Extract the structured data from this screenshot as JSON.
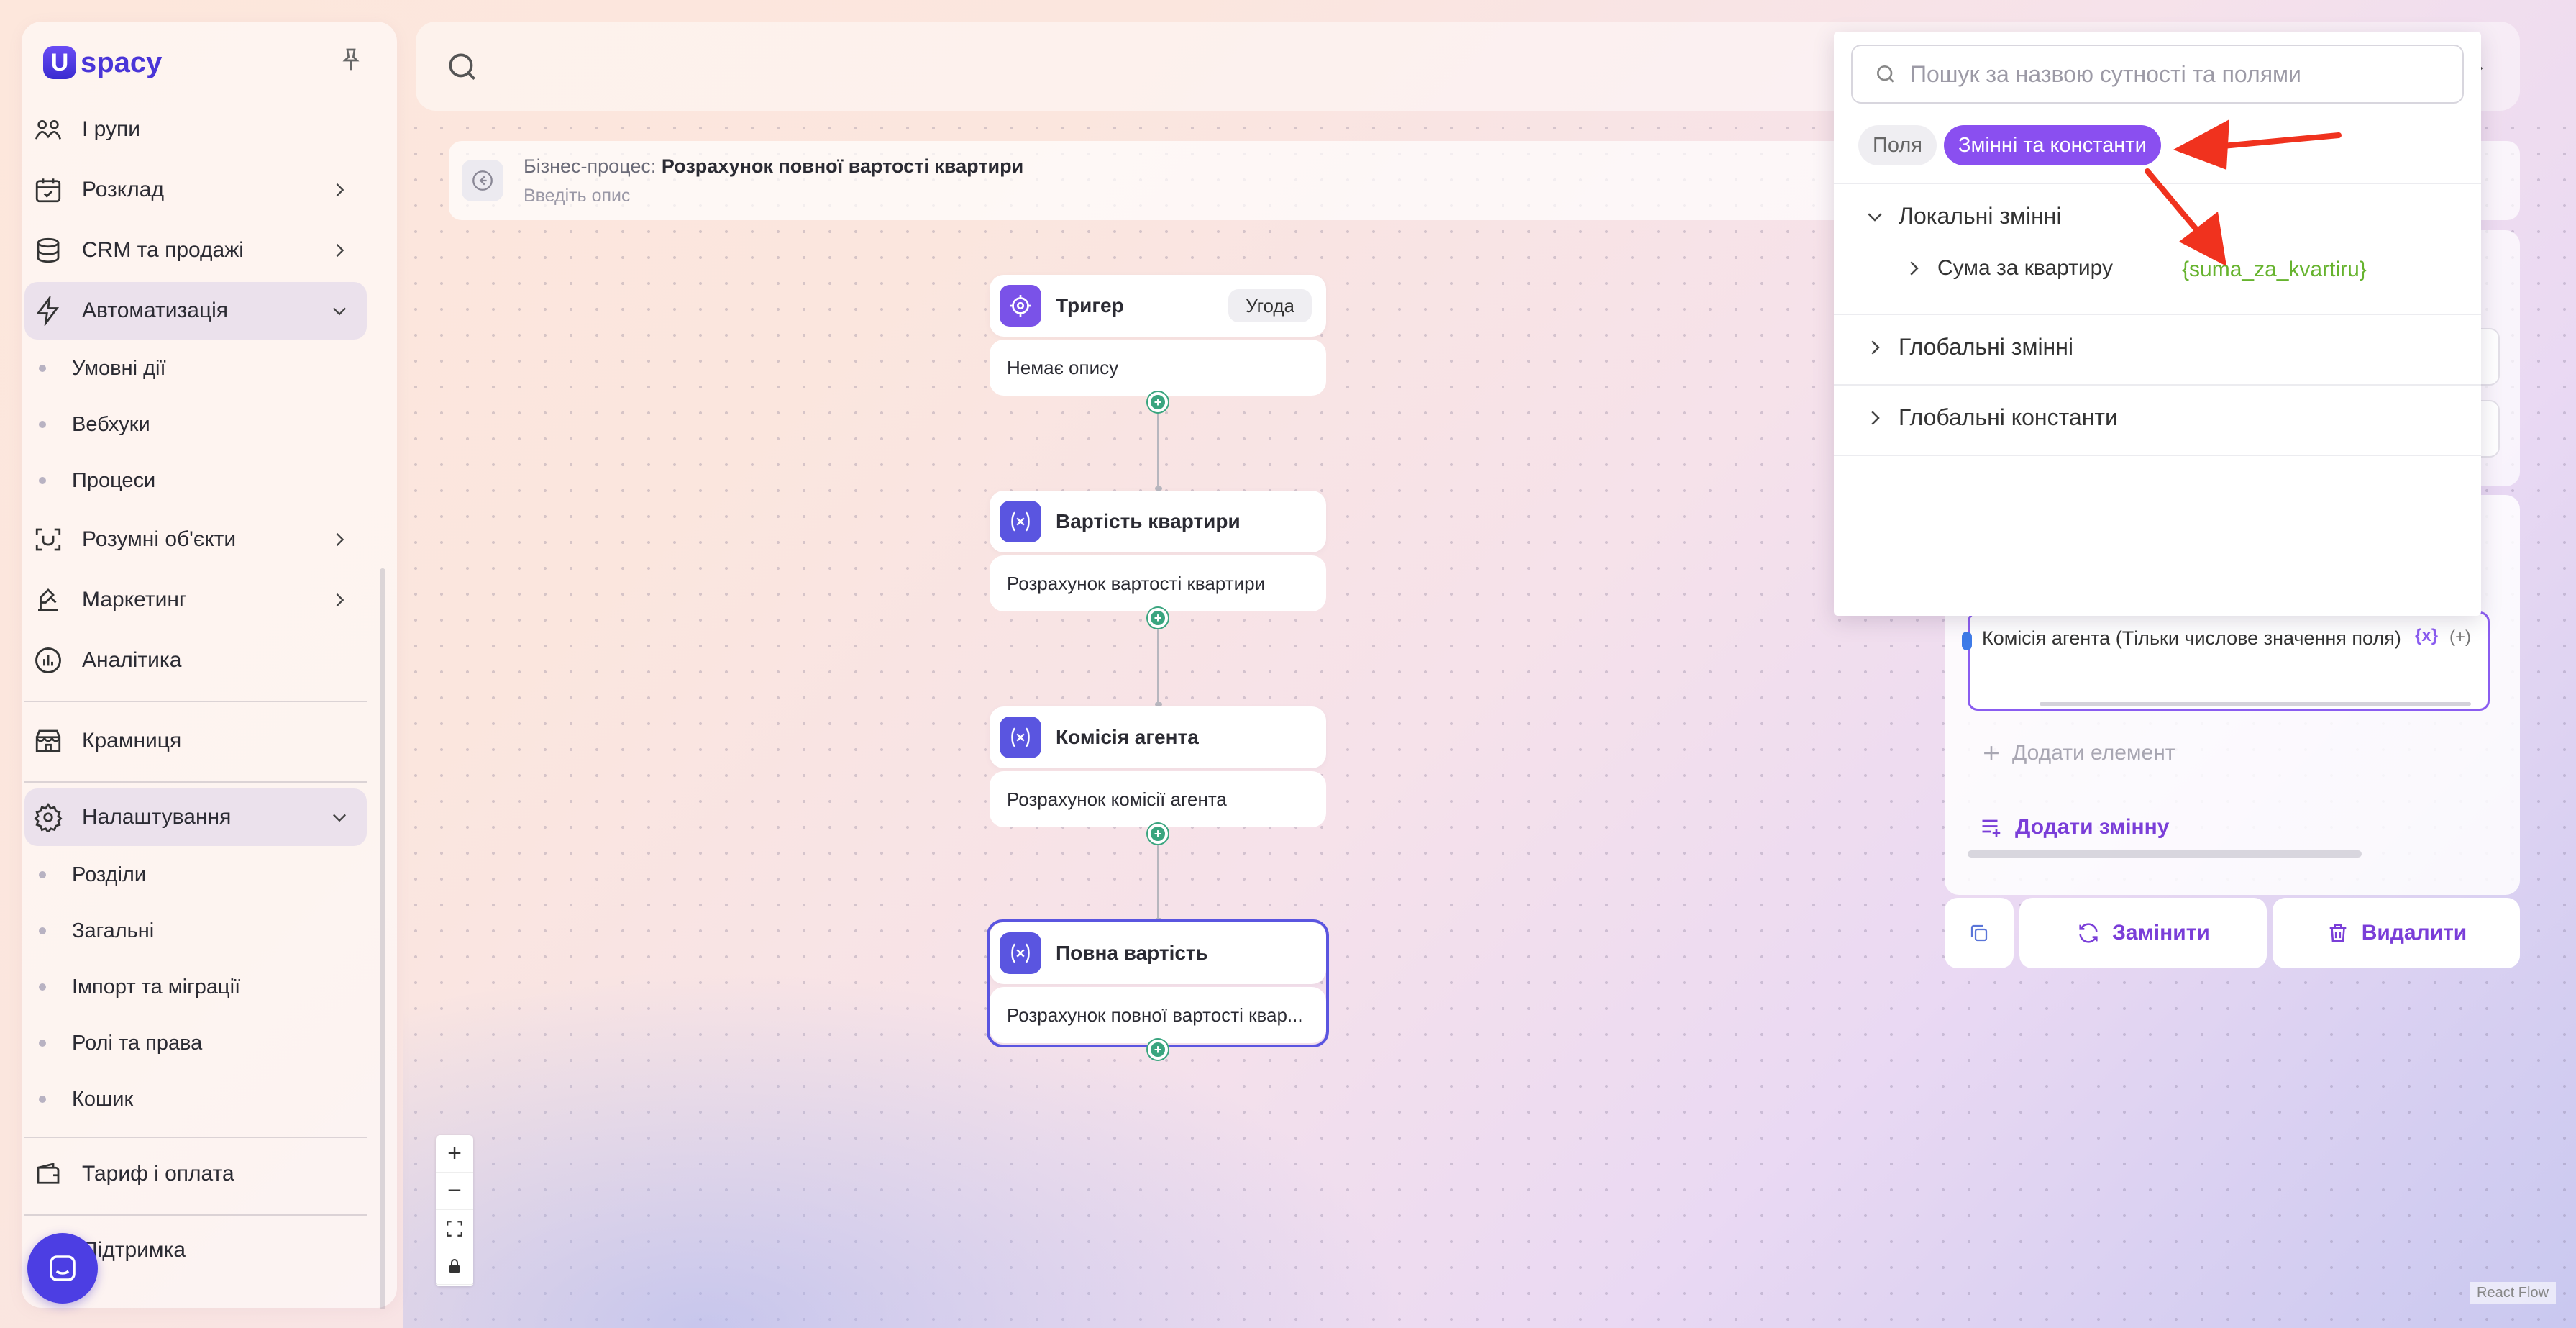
{
  "app": {
    "logo_text": "spacy",
    "logo_letter": "U"
  },
  "sidebar": {
    "items": [
      {
        "label": "І рупи",
        "icon": "groups-icon"
      },
      {
        "label": "Розклад",
        "icon": "calendar-icon"
      },
      {
        "label": "CRM та продажі",
        "icon": "database-icon"
      },
      {
        "label": "Автоматизація",
        "icon": "lightning-icon",
        "expanded": true
      },
      {
        "label": "Розумні об'єкти",
        "icon": "scan-icon"
      },
      {
        "label": "Маркетинг",
        "icon": "marketing-icon"
      },
      {
        "label": "Аналітика",
        "icon": "analytics-icon"
      },
      {
        "label": "Крамниця",
        "icon": "store-icon"
      },
      {
        "label": "Налаштування",
        "icon": "gear-icon",
        "expanded": true
      },
      {
        "label": "Тариф і оплата",
        "icon": "wallet-icon"
      },
      {
        "label": "Підтримка",
        "icon": "support-icon"
      }
    ],
    "automation_sub": [
      "Умовні дії",
      "Вебхуки",
      "Процеси"
    ],
    "settings_sub": [
      "Розділи",
      "Загальні",
      "Імпорт та міграції",
      "Ролі та права",
      "Кошик"
    ]
  },
  "process": {
    "label": "Бізнес-процес:",
    "name": "Розрахунок повної вартості квартири",
    "description_placeholder": "Введіть опис"
  },
  "nodes": [
    {
      "title": "Тригер",
      "badge": "Угода",
      "desc": "Немає опису",
      "icon": "target-icon"
    },
    {
      "title": "Вартість квартири",
      "desc": "Розрахунок вартості квартири",
      "icon": "variable-icon"
    },
    {
      "title": "Комісія агента",
      "desc": "Розрахунок комісії агента",
      "icon": "variable-icon"
    },
    {
      "title": "Повна вартість",
      "desc": "Розрахунок повної вартості квар...",
      "icon": "variable-icon",
      "selected": true
    }
  ],
  "dropdown": {
    "search_placeholder": "Пошук за назвою сутності та полями",
    "tabs": [
      "Поля",
      "Змінні та константи"
    ],
    "active_tab": "Змінні та константи",
    "groups": [
      {
        "label": "Локальні змінні",
        "expanded": true,
        "children": [
          {
            "label": "Сума за квартиру",
            "code": "{suma_za_kvartiru}"
          }
        ]
      },
      {
        "label": "Глобальні змінні",
        "expanded": false
      },
      {
        "label": "Глобальні константи",
        "expanded": false
      }
    ]
  },
  "editor": {
    "formula_text": "Комісія агента (Тільки числове значення поля)",
    "formula_chip": "{x}",
    "formula_chip2": "(+)",
    "formula_prefix": "{x}",
    "add_element": "Додати елемент",
    "add_variable": "Додати змінну",
    "replace": "Замінити",
    "delete": "Видалити"
  },
  "footer": {
    "react_flow": "React Flow"
  },
  "colors": {
    "accent": "#8a4ff0",
    "brand": "#4a35d8",
    "node_icon": "#5a55e0",
    "trigger_icon": "#7a52e8",
    "handle": "#3aa57f",
    "annotation": "#f0321e",
    "code_green": "#66b32e"
  }
}
